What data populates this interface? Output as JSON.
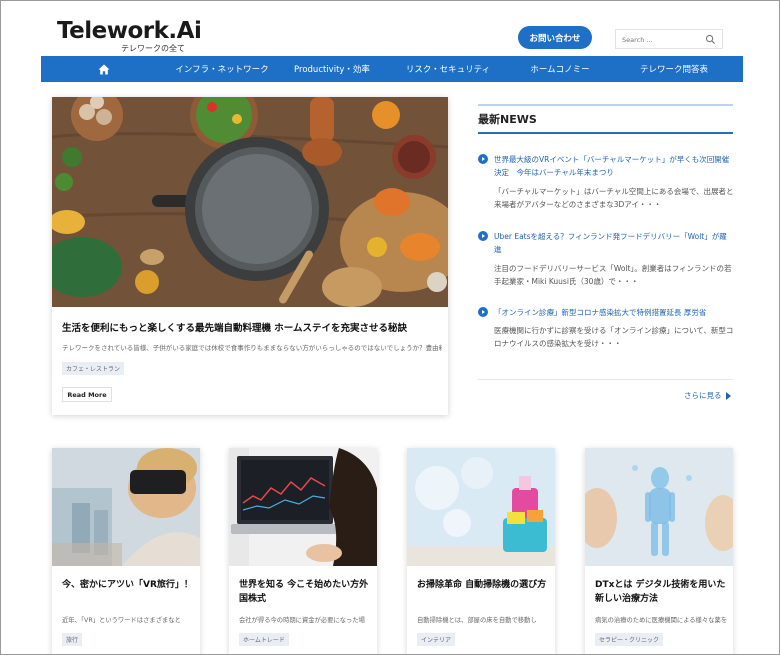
{
  "header": {
    "logo_title": "Telework.Ai",
    "logo_subtitle": "テレワークの全て",
    "contact_label": "お問い合わせ",
    "search_placeholder": "Search ..."
  },
  "nav": {
    "items": [
      {
        "label": "インフラ・ネットワーク"
      },
      {
        "label": "Productivity・効率"
      },
      {
        "label": "リスク・セキュリティ"
      },
      {
        "label": "ホームコノミー"
      },
      {
        "label": "テレワーク問答表"
      }
    ]
  },
  "featured": {
    "title": "生活を便利にもっと楽しくする最先端自動料理機 ホームステイを充実させる秘訣",
    "excerpt": "テレワークをされている皆様、子供がいる家庭では休校で食事作りもままならない方がいらっしゃるのではないでしょうか？豊由料",
    "tag": "カフェ・レストラン",
    "read_more": "Read More"
  },
  "news": {
    "title": "最新NEWS",
    "items": [
      {
        "title": "世界最大級のVRイベント「バーチャルマーケット」が早くも次回開催決定　今年はバーチャル年末まつり",
        "desc": "「バーチャルマーケット」はバーチャル空間上にある会場で、出展者と来場者がアバターなどのさまざまな3Dアイ・・・"
      },
      {
        "title": "Uber Eatsを超える？フィンランド発フードデリバリー「Wolt」が躍進",
        "desc": "注目のフードデリバリーサービス「Wolt」。創業者はフィンランドの若手起業家・Miki Kuusi氏（30歳）で・・・"
      },
      {
        "title": "「オンライン診療」新型コロナ感染拡大で特例措置延長 厚労省",
        "desc": "医療機関に行かずに診察を受ける「オンライン診療」について、新型コロナウイルスの感染拡大を受け・・・"
      }
    ],
    "more_label": "さらに見る"
  },
  "cards": [
    {
      "title": "今、密かにアツい「VR旅行」！",
      "excerpt": "近年、「VR」というワードはさまざまなと",
      "tag": "旅行"
    },
    {
      "title": "世界を知る 今こそ始めたい方外国株式",
      "excerpt": "会社が得る今の時期に資金が必要になった場",
      "tag": "ホームトレード"
    },
    {
      "title": "お掃除革命 自動掃除機の選び方",
      "excerpt": "自動掃除機とは、部屋の床を自動で移動し",
      "tag": "インテリア"
    },
    {
      "title": "DTxとは デジタル技術を用いた新しい治療方法",
      "excerpt": "病気の治療のために医療機関による様々な薬を処方",
      "tag": "セラピー・クリニック"
    }
  ],
  "colors": {
    "brand_blue": "#1e70c7",
    "link_blue": "#1e62b5"
  }
}
